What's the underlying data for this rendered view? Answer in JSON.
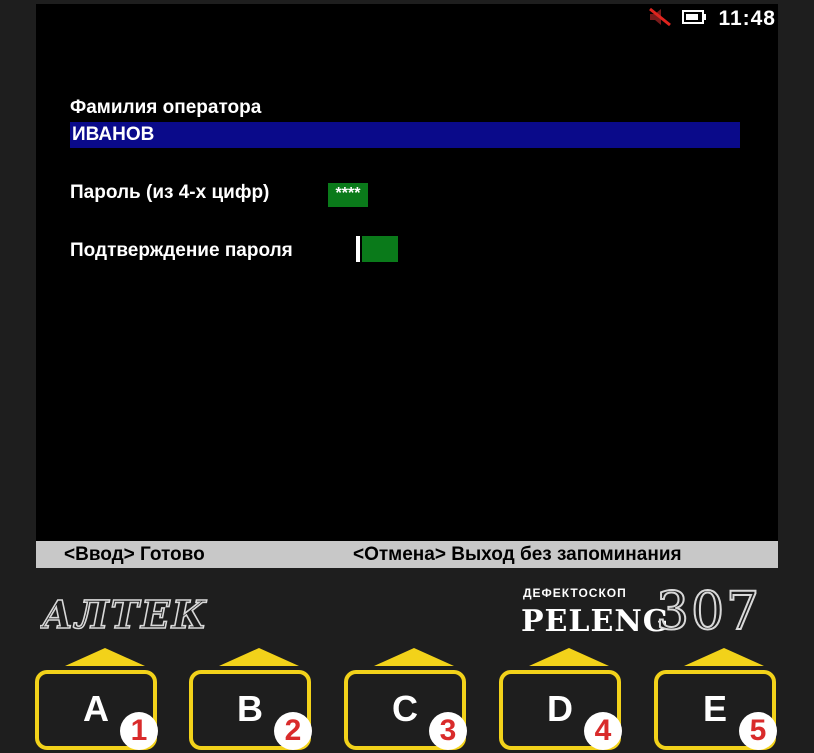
{
  "status": {
    "mute_icon": "speaker-muted-icon",
    "battery_icon": "battery-icon",
    "time": "11:48"
  },
  "form": {
    "operator_label": "Фамилия оператора",
    "operator_value": "ИВАНОВ",
    "password_label": "Пароль (из 4-х цифр)",
    "password_value": "****",
    "confirm_label": "Подтверждение пароля",
    "confirm_value": ""
  },
  "hints": {
    "enter": "<Ввод> Готово",
    "cancel": "<Отмена> Выход без запоминания"
  },
  "brand": {
    "maker": "АЛТЕК",
    "device_type": "ДЕФЕКТОСКОП",
    "name": "PELENG",
    "model": "307"
  },
  "keys": [
    {
      "letter": "A",
      "number": "1"
    },
    {
      "letter": "B",
      "number": "2"
    },
    {
      "letter": "C",
      "number": "3"
    },
    {
      "letter": "D",
      "number": "4"
    },
    {
      "letter": "E",
      "number": "5"
    }
  ],
  "colors": {
    "highlight_field": "#0a0a8a",
    "password_field": "#0a7a1a",
    "key_accent": "#f2d21a",
    "key_number": "#d92b2b"
  }
}
